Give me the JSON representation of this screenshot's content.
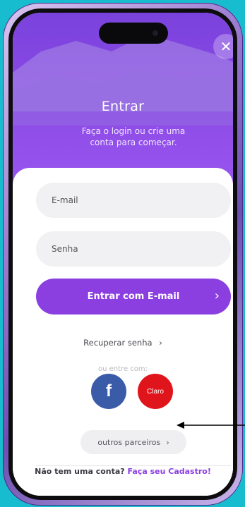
{
  "header": {
    "title": "Entrar",
    "subtitle": "Faça o login ou crie uma conta para começar.",
    "close_icon": "close-icon"
  },
  "form": {
    "email_placeholder": "E-mail",
    "password_placeholder": "Senha",
    "submit_label": "Entrar com E-mail",
    "submit_chevron": "›"
  },
  "links": {
    "recover_password": "Recuperar senha",
    "recover_chevron": "›",
    "or_login_with": "ou entre com:"
  },
  "social": {
    "facebook_glyph": "f",
    "claro_label": "Claro"
  },
  "partners": {
    "label": "outros parceiros",
    "chevron": "›"
  },
  "footer": {
    "question": "Não tem uma conta?",
    "signup_link": "Faça seu Cadastro!"
  },
  "colors": {
    "background": "#17bccf",
    "brand_purple": "#8b3fe0",
    "facebook_blue": "#3a5ca8",
    "claro_red": "#e0151b"
  }
}
